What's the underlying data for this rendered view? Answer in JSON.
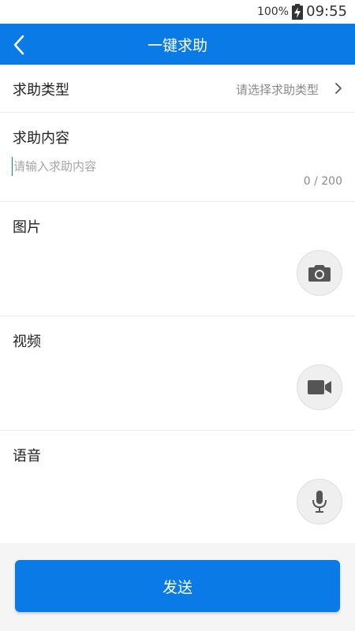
{
  "status_bar": {
    "battery_percent": "100%",
    "battery_icon": "battery-charging-icon",
    "time": "09:55"
  },
  "header": {
    "back_icon": "chevron-left-icon",
    "title": "一键求助",
    "background_color": "#0a7be6"
  },
  "form": {
    "help_type": {
      "label": "求助类型",
      "placeholder_value": "请选择求助类型",
      "icon": "chevron-right-icon"
    },
    "help_content": {
      "label": "求助内容",
      "placeholder": "请输入求助内容",
      "value": "",
      "char_count": "0 / 200"
    },
    "image": {
      "label": "图片",
      "icon": "camera-icon"
    },
    "video": {
      "label": "视频",
      "icon": "video-camera-icon"
    },
    "voice": {
      "label": "语音",
      "icon": "microphone-icon"
    }
  },
  "footer": {
    "send_label": "发送"
  }
}
